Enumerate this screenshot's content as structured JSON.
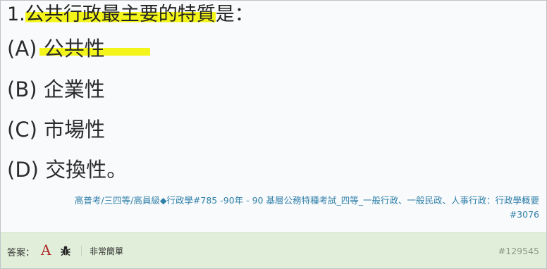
{
  "question": {
    "prefix": "1.",
    "highlighted": "公共行政最主要的特質",
    "suffix": "是："
  },
  "options": [
    {
      "label": "(A)",
      "text": "公共性",
      "highlighted": true
    },
    {
      "label": "(B)",
      "text": "企業性",
      "highlighted": false
    },
    {
      "label": "(C)",
      "text": "市場性",
      "highlighted": false
    },
    {
      "label": "(D)",
      "text": "交換性。",
      "highlighted": false
    }
  ],
  "source": {
    "line1": "高普考/三四等/高員級◆行政學#785 -90年 - 90 基層公務特種考試_四等_一般行政、一般民政、人事行政：行政學概要",
    "line2": "#3076"
  },
  "footer": {
    "answer_label": "答案：",
    "answer_value": "A",
    "difficulty": "非常簡單",
    "question_id": "#129545"
  },
  "colors": {
    "highlight": "#f3f51a",
    "answer": "#b02a2a",
    "link": "#2f7fa8",
    "footer_bg": "#e1efda"
  }
}
